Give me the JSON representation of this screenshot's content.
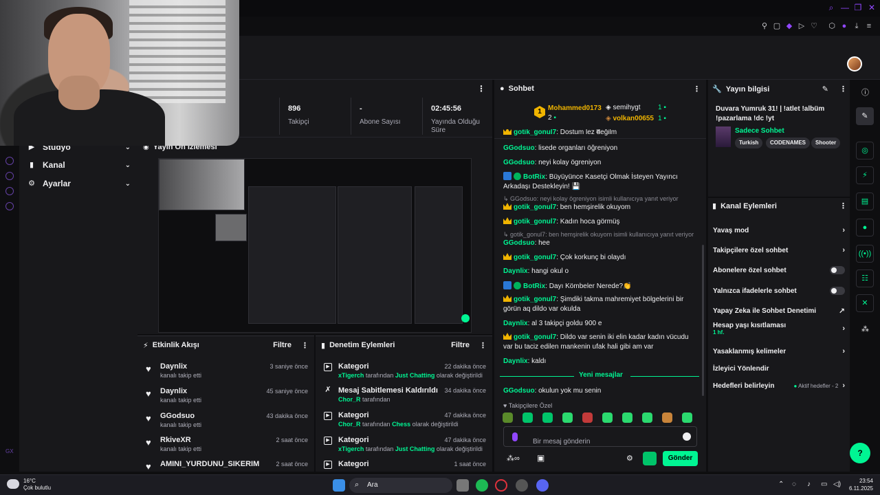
{
  "app": {
    "user_label": "GX"
  },
  "nav": {
    "items": [
      {
        "label": "Stüdyo"
      },
      {
        "label": "Kanal"
      },
      {
        "label": "Ayarlar"
      }
    ]
  },
  "stats": [
    {
      "value": "896",
      "label": "Takipçi"
    },
    {
      "value": "-",
      "label": "Abone Sayısı"
    },
    {
      "value": "02:45:56",
      "label": "Yayında Olduğu Süre"
    }
  ],
  "preview": {
    "title": "Yayın Ön İzlemesi"
  },
  "events": {
    "title": "Etkinlik Akışı",
    "filter_label": "Filtre",
    "items": [
      {
        "name": "Daynlix",
        "sub": "kanalı takip etti",
        "time": "3 saniye önce"
      },
      {
        "name": "Daynlix",
        "sub": "kanalı takip etti",
        "time": "45 saniye önce"
      },
      {
        "name": "GGodsuo",
        "sub": "kanalı takip etti",
        "time": "43 dakika önce"
      },
      {
        "name": "RkiveXR",
        "sub": "kanalı takip etti",
        "time": "2 saat önce"
      },
      {
        "name": "AMINI_YURDUNU_SIKERIM",
        "sub": "",
        "time": "2 saat önce"
      }
    ]
  },
  "audit": {
    "title": "Denetim Eylemleri",
    "filter_label": "Filtre",
    "items": [
      {
        "name": "Kategori",
        "actor": "xTigerch",
        "mid": " tarafından ",
        "target": "Just Chatting",
        "tail": " olarak değiştirildi",
        "time": "22 dakika önce"
      },
      {
        "name": "Mesaj Sabitlemesi Kaldırıldı",
        "actor": "Chor_R",
        "mid": " tarafından",
        "target": "",
        "tail": "",
        "time": "34 dakika önce"
      },
      {
        "name": "Kategori",
        "actor": "Chor_R",
        "mid": " tarafından ",
        "target": "Chess",
        "tail": " olarak değiştirildi",
        "time": "47 dakika önce"
      },
      {
        "name": "Kategori",
        "actor": "xTigerch",
        "mid": " tarafından ",
        "target": "Just Chatting",
        "tail": " olarak değiştirildi",
        "time": "47 dakika önce"
      },
      {
        "name": "Kategori",
        "actor": "",
        "mid": "",
        "target": "",
        "tail": "",
        "time": "1 saat önce"
      }
    ]
  },
  "chat": {
    "title": "Sohbet",
    "leader": {
      "rank": "1",
      "name": "Mohammed0173",
      "count": "2",
      "users": [
        {
          "name": "semihygt",
          "count": "1"
        },
        {
          "name": "volkan00655",
          "count": "1"
        }
      ]
    },
    "messages": [
      {
        "user": "gotik_gonul7",
        "badge": "crown",
        "text": "Dostum lez değilm",
        "color": "#00f593"
      },
      {
        "user": "GGodsuo",
        "badge": "",
        "text": "lisede organları öğreniyon",
        "color": "#00f593"
      },
      {
        "user": "GGodsuo",
        "badge": "",
        "text": "neyi kolay ögreniyon",
        "color": "#00f593"
      },
      {
        "user": "BotRix",
        "badge": "bot",
        "text": "Büyüyünce Kasetçi Olmak İsteyen Yayıncı Arkadaşı Destekleyin! 💾",
        "color": "#00f593"
      },
      {
        "user": "gotik_gonul7",
        "badge": "crown",
        "text": "ben hemşirelik okuyom",
        "color": "#00f593"
      },
      {
        "user": "gotik_gonul7",
        "badge": "crown",
        "text": "Kadın hoca görmüş",
        "color": "#00f593"
      },
      {
        "user": "GGodsuo",
        "badge": "",
        "text": "hee",
        "color": "#00f593"
      },
      {
        "user": "gotik_gonul7",
        "badge": "crown",
        "text": "Çok korkunç bi olaydı",
        "color": "#00f593"
      },
      {
        "user": "Daynlix",
        "badge": "",
        "text": "hangi okul o",
        "color": "#00f593"
      },
      {
        "user": "BotRix",
        "badge": "bot",
        "text": "Dayı Kömbeler Nerede?👏",
        "color": "#00f593"
      },
      {
        "user": "gotik_gonul7",
        "badge": "crown",
        "text": "Şimdiki takma mahremiyet bölgelerini bir görün aq dildo var okulda",
        "color": "#00f593"
      },
      {
        "user": "Daynlix",
        "badge": "",
        "text": "al 3 takipçi goldu 900 e",
        "color": "#00f593"
      },
      {
        "user": "gotik_gonul7",
        "badge": "crown",
        "text": "Dildo var senin iki elin kadar kadın vücudu var bu taciz edilen mankenin ufak hali gibi am var",
        "color": "#00f593"
      },
      {
        "user": "Daynlix",
        "badge": "",
        "text": "kaldı",
        "color": "#00f593"
      },
      {
        "user": "GGodsuo",
        "badge": "",
        "text": "okulun yok mu senin",
        "color": "#00f593"
      }
    ],
    "replies": [
      "GGodsuo: neyi kolay ögreniyon isimli kullanıcıya yanıt veriyor",
      "gotik_gonul7: ben hemşirelik okuyom isimli kullanıcıya yanıt veriyor"
    ],
    "new_messages_label": "Yeni mesajlar",
    "emote_section_label": "Takipçilere Özel",
    "input_placeholder": "Bir mesaj gönderin",
    "send_label": "Gönder"
  },
  "info": {
    "title": "Yayın bilgisi",
    "stream_title": "Duvara Yumruk 31! | !atlet !albüm !pazarlama !dc !yt",
    "category": "Sadece Sohbet",
    "tags": [
      "Turkish",
      "CODENAMES",
      "Shooter"
    ]
  },
  "actions": {
    "title": "Kanal Eylemleri",
    "items": [
      {
        "label": "Yavaş mod",
        "kind": "chevron",
        "sub": ""
      },
      {
        "label": "Takipçilere özel sohbet",
        "kind": "chevron",
        "sub": ""
      },
      {
        "label": "Abonelere özel sohbet",
        "kind": "toggle",
        "sub": ""
      },
      {
        "label": "Yalnızca ifadelerle sohbet",
        "kind": "toggle",
        "sub": ""
      },
      {
        "label": "Yapay Zeka ile Sohbet Denetimi",
        "kind": "external",
        "sub": ""
      },
      {
        "label": "Hesap yaşı kısıtlaması",
        "kind": "chevron",
        "sub": "1 hf."
      },
      {
        "label": "Yasaklanmış kelimeler",
        "kind": "chevron",
        "sub": ""
      },
      {
        "label": "İzleyici Yönlendir",
        "kind": "none",
        "sub": ""
      },
      {
        "label": "Hedefleri belirleyin",
        "kind": "chevron",
        "sub": "Aktif hedefler - 2"
      }
    ]
  },
  "taskbar": {
    "weather_temp": "16°C",
    "weather_desc": "Çok bulutlu",
    "search_label": "Ara",
    "time": "23:54",
    "date": "6.11.2025"
  },
  "colors": {
    "accent": "#00f593",
    "brand": "#9147ff",
    "bg": "#18181b"
  }
}
